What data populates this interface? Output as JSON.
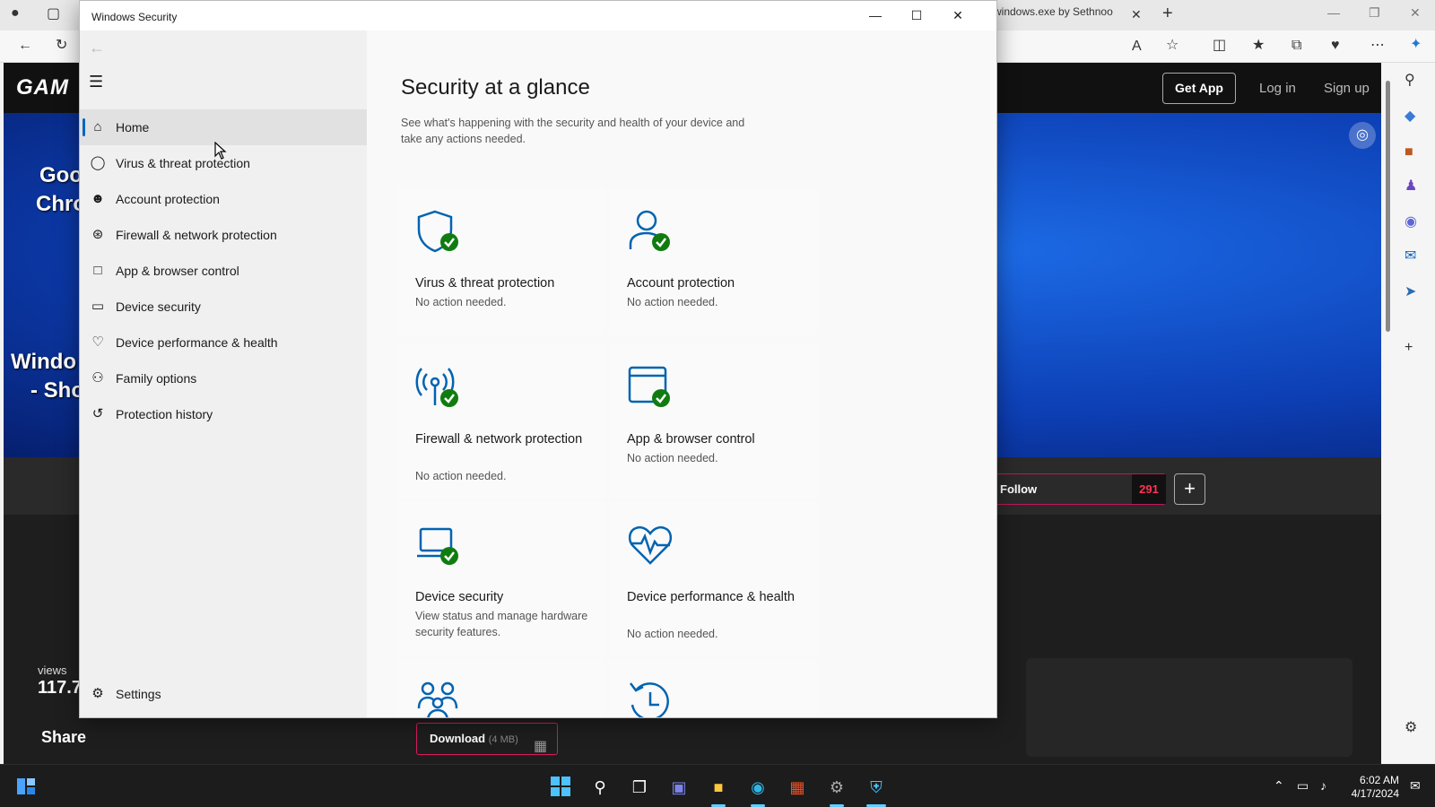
{
  "browser": {
    "tab_title": "windows.exe by Sethnoo",
    "site_logo": "GAM",
    "get_app": "Get App",
    "log_in": "Log in",
    "sign_up": "Sign up",
    "desktop_text_1": "Goo",
    "desktop_text_2": "Chro",
    "desktop_text_3": "Windo",
    "desktop_text_4": "- Sho",
    "follow": "Follow",
    "follow_count": "291",
    "views_label": "views",
    "views_value": "117.7",
    "share": "Share",
    "download_label": "Download",
    "download_size": "(4 MB)"
  },
  "window": {
    "title": "Windows Security"
  },
  "nav": {
    "items": [
      {
        "label": "Home",
        "icon": "home-icon"
      },
      {
        "label": "Virus & threat protection",
        "icon": "shield-icon"
      },
      {
        "label": "Account protection",
        "icon": "person-icon"
      },
      {
        "label": "Firewall & network protection",
        "icon": "wifi-antenna-icon"
      },
      {
        "label": "App & browser control",
        "icon": "app-window-icon"
      },
      {
        "label": "Device security",
        "icon": "laptop-icon"
      },
      {
        "label": "Device performance & health",
        "icon": "heart-icon"
      },
      {
        "label": "Family options",
        "icon": "family-icon"
      },
      {
        "label": "Protection history",
        "icon": "history-icon"
      }
    ],
    "settings": "Settings",
    "selected": "Home"
  },
  "main": {
    "heading": "Security at a glance",
    "subheading": "See what's happening with the security and health of your device and take any actions needed.",
    "cards": [
      {
        "title": "Virus & threat protection",
        "desc": "No action needed.",
        "icon": "shield-check-icon"
      },
      {
        "title": "Account protection",
        "desc": "No action needed.",
        "icon": "person-check-icon"
      },
      {
        "title": "Firewall & network protection",
        "desc": "No action needed.",
        "icon": "antenna-check-icon"
      },
      {
        "title": "App & browser control",
        "desc": "No action needed.",
        "icon": "app-check-icon"
      },
      {
        "title": "Device security",
        "desc": "View status and manage hardware security features.",
        "icon": "laptop-check-icon"
      },
      {
        "title": "Device performance & health",
        "desc": "No action needed.",
        "icon": "heartbeat-icon"
      },
      {
        "title": "",
        "desc": "",
        "icon": "family-icon"
      },
      {
        "title": "",
        "desc": "",
        "icon": "history-icon"
      }
    ]
  },
  "taskbar": {
    "time": "6:02 AM",
    "date": "4/17/2024"
  },
  "colors": {
    "accent": "#0067c0",
    "check": "#107c10",
    "icon_blue": "#0063b1"
  }
}
